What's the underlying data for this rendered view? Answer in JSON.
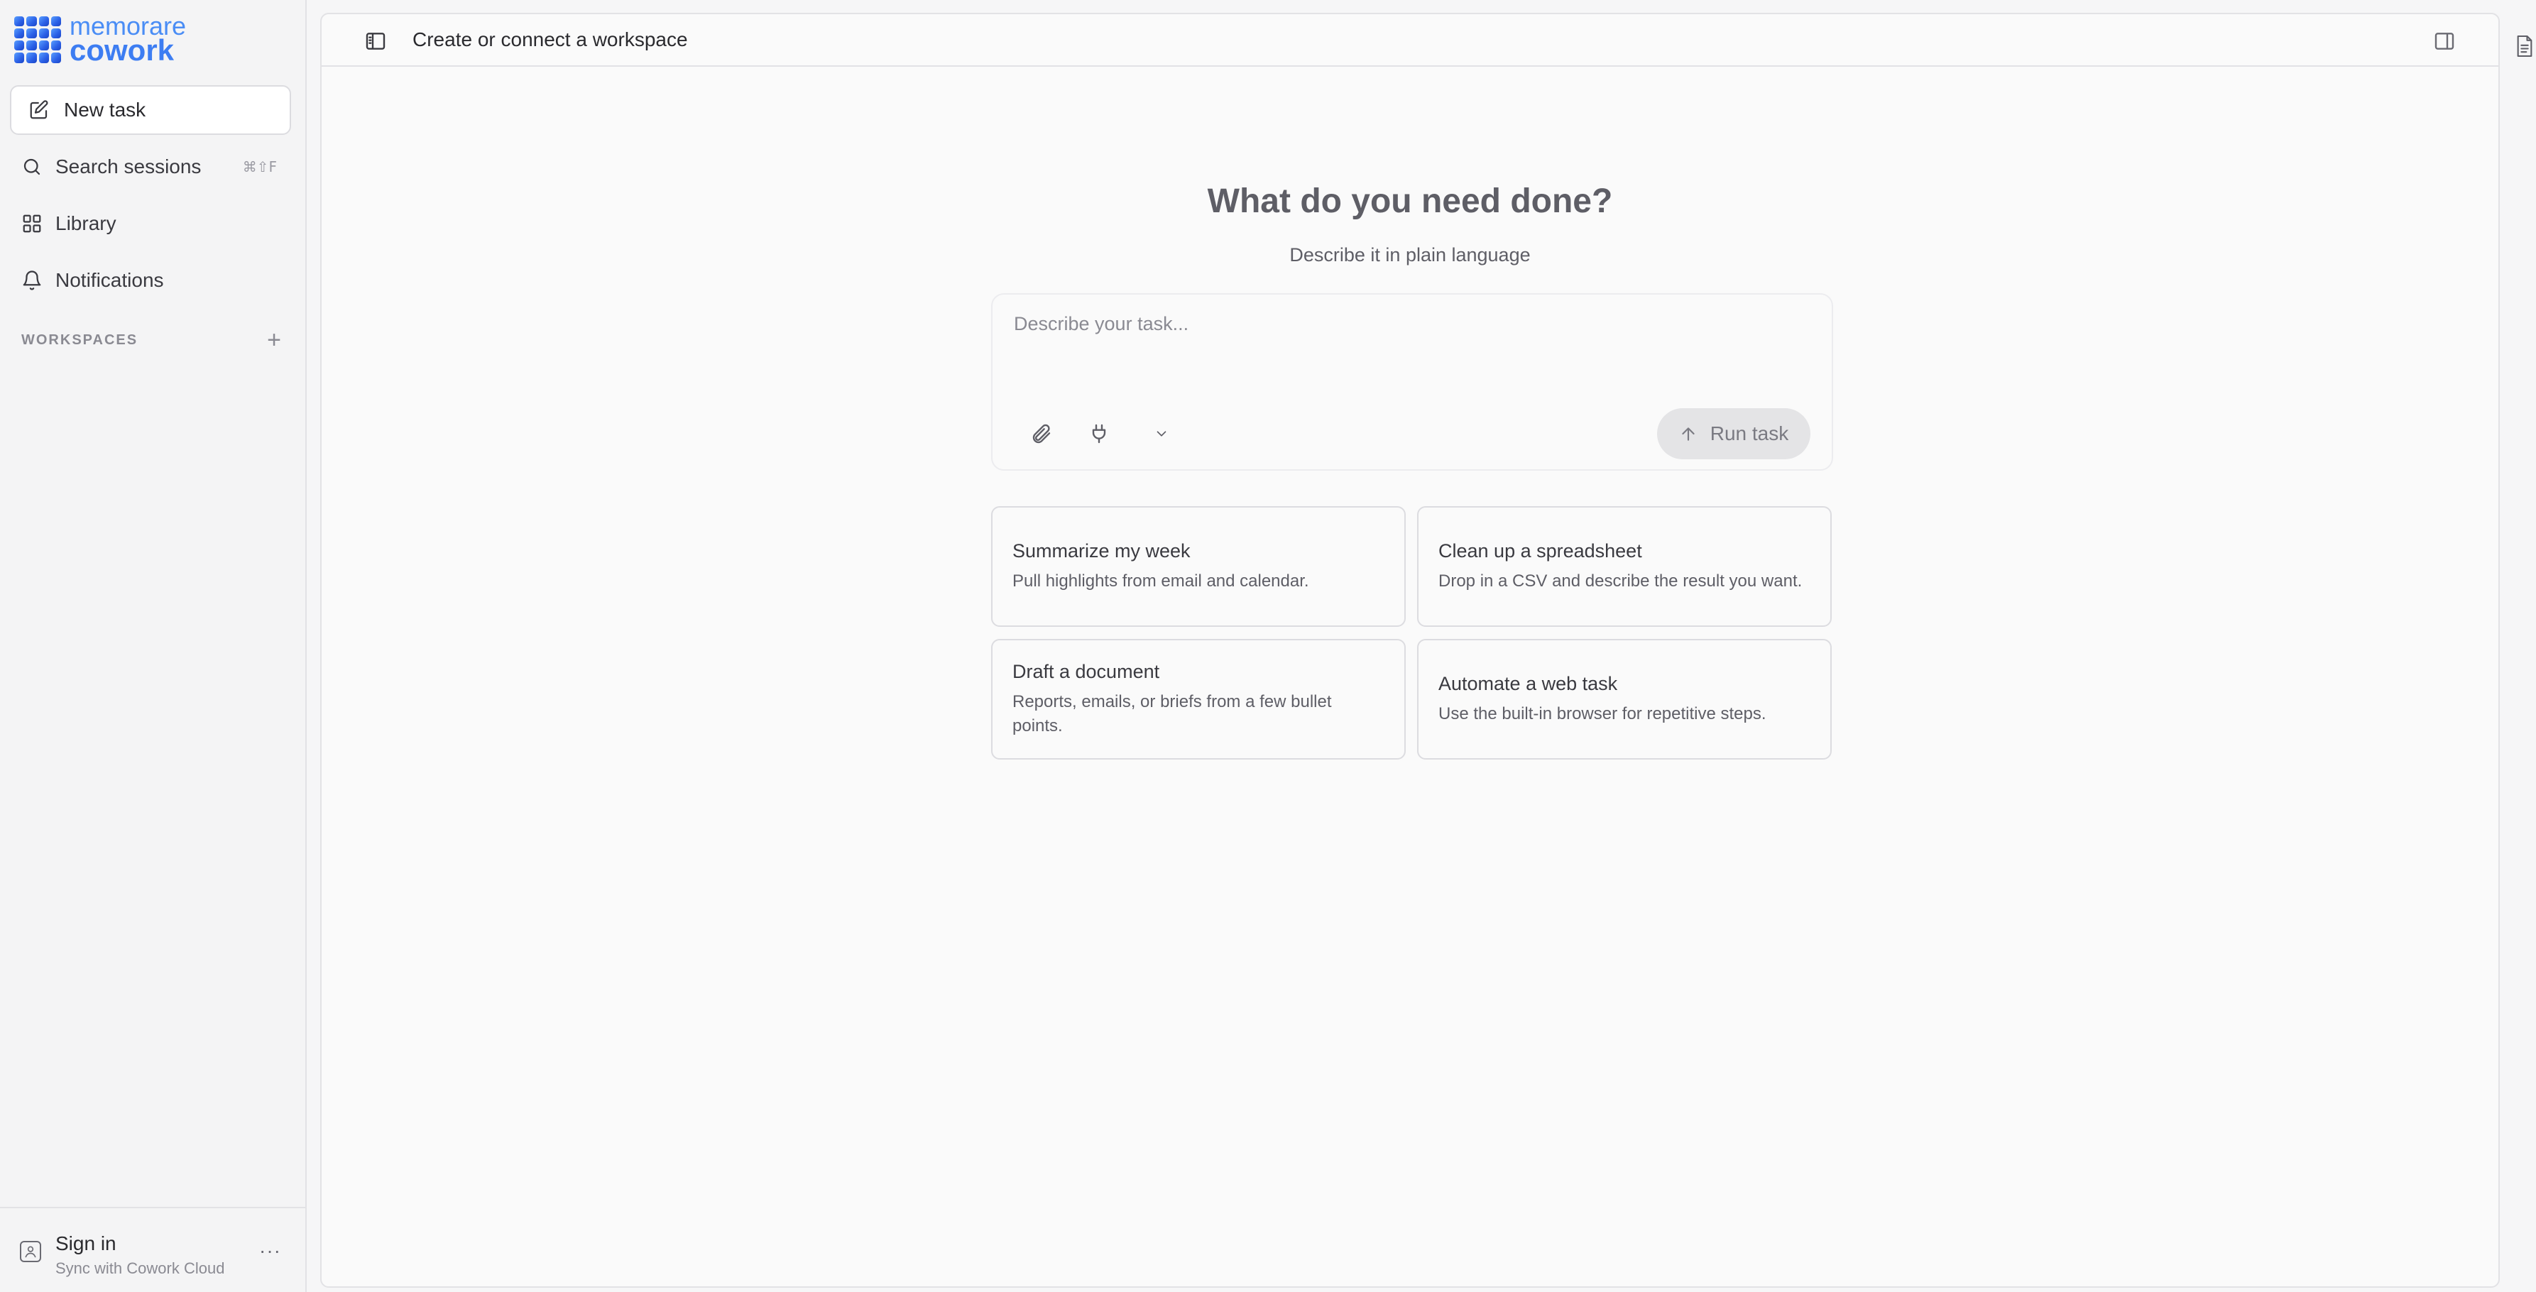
{
  "brand": {
    "name_top": "memorare",
    "name_bottom": "cowork"
  },
  "sidebar": {
    "new_task": "New task",
    "items": [
      {
        "label": "Search sessions",
        "shortcut": "⌘⇧F"
      },
      {
        "label": "Library"
      },
      {
        "label": "Notifications"
      }
    ],
    "workspaces_label": "WORKSPACES",
    "footer": {
      "signin": "Sign in",
      "subtitle": "Sync with Cowork Cloud",
      "more": "···"
    }
  },
  "header": {
    "title": "Create or connect a workspace"
  },
  "hero": {
    "title": "What do you need done?",
    "subtitle": "Describe it in plain language"
  },
  "composer": {
    "placeholder": "Describe your task...",
    "run_label": "Run task"
  },
  "suggestions": [
    {
      "title": "Summarize my week",
      "desc": "Pull highlights from email and calendar."
    },
    {
      "title": "Clean up a spreadsheet",
      "desc": "Drop in a CSV and describe the result you want."
    },
    {
      "title": "Draft a document",
      "desc": "Reports, emails, or briefs from a few bullet points."
    },
    {
      "title": "Automate a web task",
      "desc": "Use the built-in browser for repetitive steps."
    }
  ],
  "colors": {
    "brand_blue": "#3d7df2",
    "accent_bg": "#e4e4e6"
  }
}
